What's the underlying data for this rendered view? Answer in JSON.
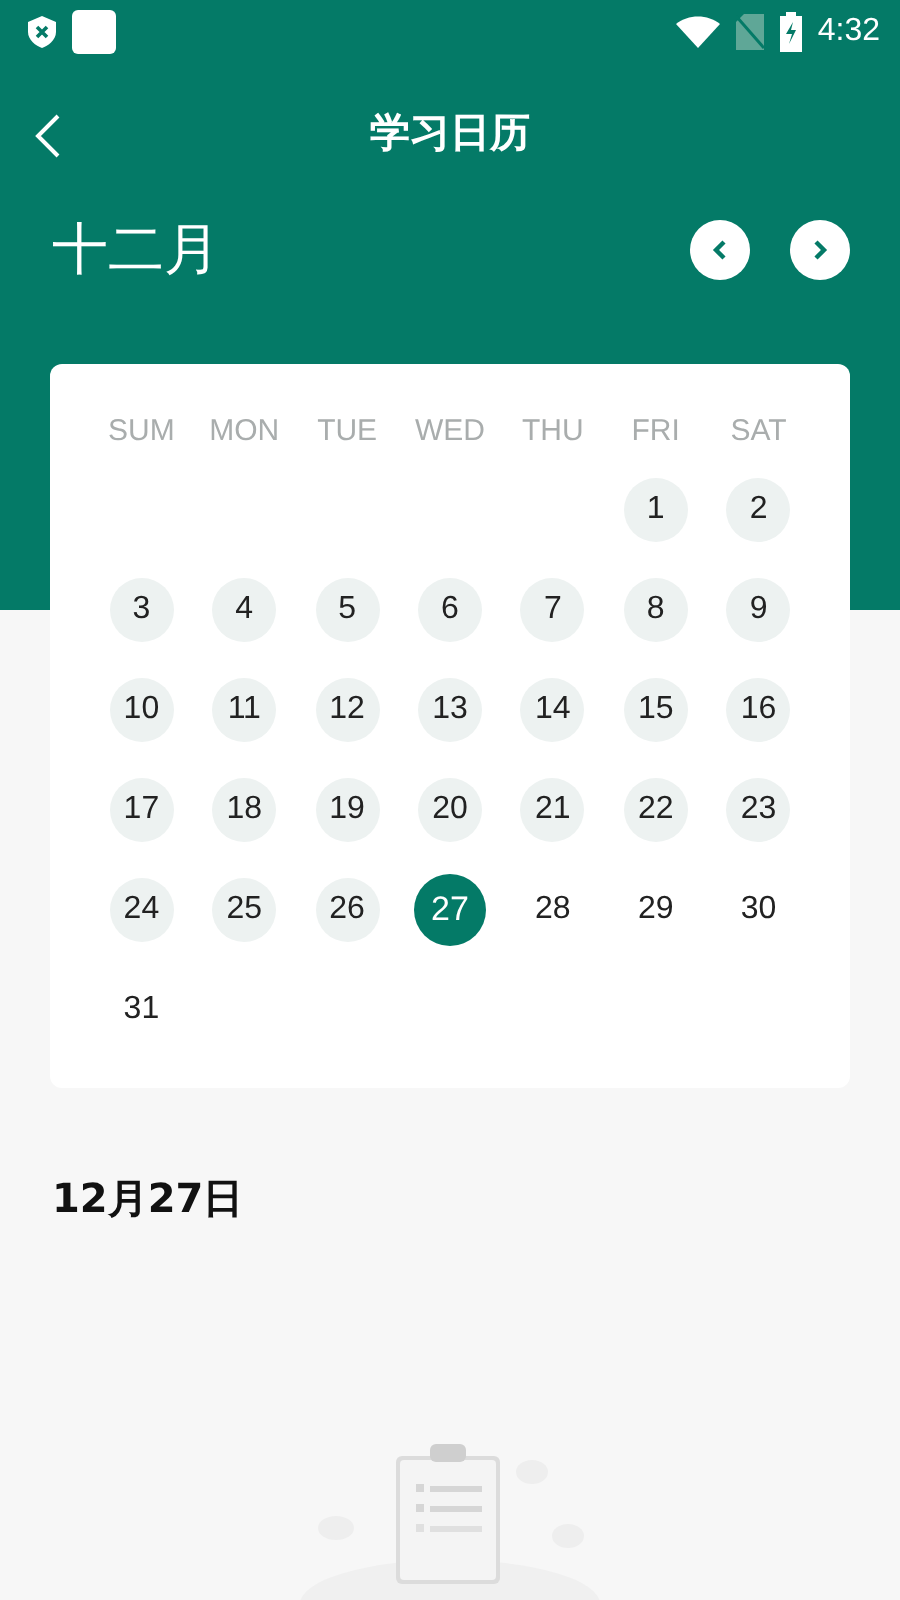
{
  "status_bar": {
    "time": "4:32"
  },
  "header": {
    "title": "学习日历"
  },
  "month": {
    "label": "十二月"
  },
  "calendar": {
    "weekdays": [
      "SUM",
      "MON",
      "TUE",
      "WED",
      "THU",
      "FRI",
      "SAT"
    ],
    "weeks": [
      [
        {
          "kind": "blank"
        },
        {
          "kind": "blank"
        },
        {
          "kind": "blank"
        },
        {
          "kind": "blank"
        },
        {
          "kind": "blank"
        },
        {
          "kind": "day",
          "day": "1",
          "marked": true,
          "selected": false
        },
        {
          "kind": "day",
          "day": "2",
          "marked": true,
          "selected": false
        }
      ],
      [
        {
          "kind": "day",
          "day": "3",
          "marked": true,
          "selected": false
        },
        {
          "kind": "day",
          "day": "4",
          "marked": true,
          "selected": false
        },
        {
          "kind": "day",
          "day": "5",
          "marked": true,
          "selected": false
        },
        {
          "kind": "day",
          "day": "6",
          "marked": true,
          "selected": false
        },
        {
          "kind": "day",
          "day": "7",
          "marked": true,
          "selected": false
        },
        {
          "kind": "day",
          "day": "8",
          "marked": true,
          "selected": false
        },
        {
          "kind": "day",
          "day": "9",
          "marked": true,
          "selected": false
        }
      ],
      [
        {
          "kind": "day",
          "day": "10",
          "marked": true,
          "selected": false
        },
        {
          "kind": "day",
          "day": "11",
          "marked": true,
          "selected": false
        },
        {
          "kind": "day",
          "day": "12",
          "marked": true,
          "selected": false
        },
        {
          "kind": "day",
          "day": "13",
          "marked": true,
          "selected": false
        },
        {
          "kind": "day",
          "day": "14",
          "marked": true,
          "selected": false
        },
        {
          "kind": "day",
          "day": "15",
          "marked": true,
          "selected": false
        },
        {
          "kind": "day",
          "day": "16",
          "marked": true,
          "selected": false
        }
      ],
      [
        {
          "kind": "day",
          "day": "17",
          "marked": true,
          "selected": false
        },
        {
          "kind": "day",
          "day": "18",
          "marked": true,
          "selected": false
        },
        {
          "kind": "day",
          "day": "19",
          "marked": true,
          "selected": false
        },
        {
          "kind": "day",
          "day": "20",
          "marked": true,
          "selected": false
        },
        {
          "kind": "day",
          "day": "21",
          "marked": true,
          "selected": false
        },
        {
          "kind": "day",
          "day": "22",
          "marked": true,
          "selected": false
        },
        {
          "kind": "day",
          "day": "23",
          "marked": true,
          "selected": false
        }
      ],
      [
        {
          "kind": "day",
          "day": "24",
          "marked": true,
          "selected": false
        },
        {
          "kind": "day",
          "day": "25",
          "marked": true,
          "selected": false
        },
        {
          "kind": "day",
          "day": "26",
          "marked": true,
          "selected": false
        },
        {
          "kind": "day",
          "day": "27",
          "selected": true
        },
        {
          "kind": "day",
          "day": "28",
          "marked": false,
          "selected": false
        },
        {
          "kind": "day",
          "day": "29",
          "marked": false,
          "selected": false
        },
        {
          "kind": "day",
          "day": "30",
          "marked": false,
          "selected": false
        }
      ],
      [
        {
          "kind": "day",
          "day": "31",
          "marked": false,
          "selected": false
        },
        {
          "kind": "blank"
        },
        {
          "kind": "blank"
        },
        {
          "kind": "blank"
        },
        {
          "kind": "blank"
        },
        {
          "kind": "blank"
        },
        {
          "kind": "blank"
        }
      ]
    ]
  },
  "selected_date": {
    "label": "12月27日"
  }
}
